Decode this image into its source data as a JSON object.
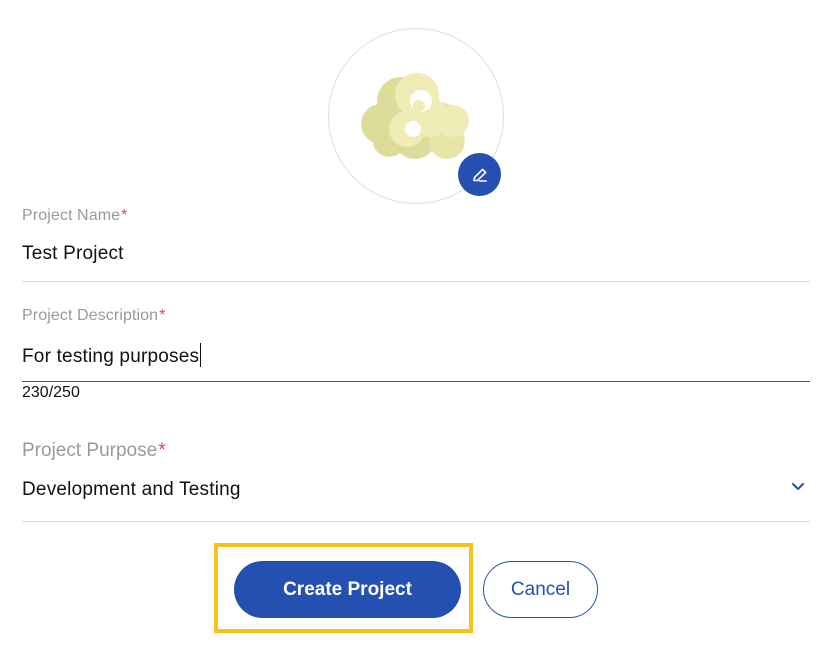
{
  "avatar": {
    "image": "popcorn-cloud-icon",
    "edit_icon": "pencil-icon"
  },
  "form": {
    "name": {
      "label": "Project Name",
      "required_mark": "*",
      "value": "Test Project"
    },
    "description": {
      "label": "Project Description",
      "required_mark": "*",
      "value": "For testing purposes",
      "counter": "230/250"
    },
    "purpose": {
      "label": "Project Purpose",
      "required_mark": "*",
      "value": "Development and Testing",
      "icon": "chevron-down-icon"
    }
  },
  "actions": {
    "create_label": "Create Project",
    "cancel_label": "Cancel"
  },
  "colors": {
    "primary": "#2450b2",
    "required": "#e0464a",
    "highlight": "#f5c518",
    "avatar_fill": "#e8e6a6"
  }
}
